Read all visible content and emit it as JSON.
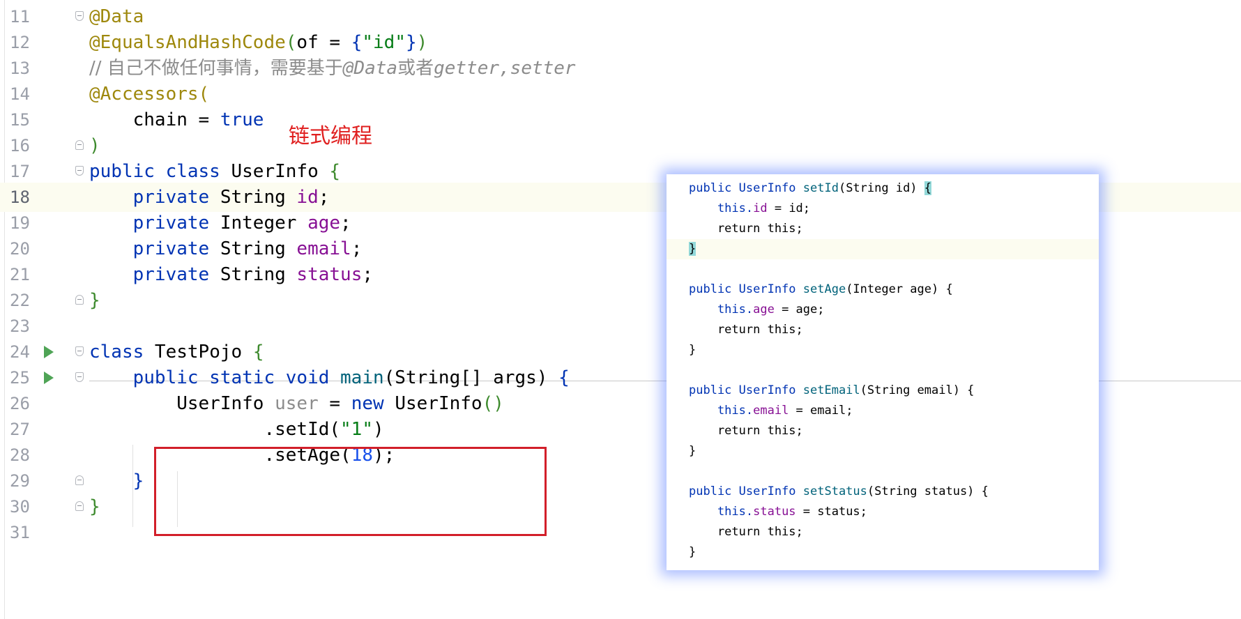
{
  "editor": {
    "lines": [
      {
        "num": "11",
        "tokens": [
          "@Data"
        ]
      },
      {
        "num": "12",
        "tokens": [
          "@EqualsAndHashCode",
          "(",
          "of = ",
          "{",
          "\"id\"",
          "}",
          ")"
        ]
      },
      {
        "num": "13",
        "tokens": [
          "// 自己不做任何事情，需要基于",
          "@Data",
          "或者",
          "getter,setter"
        ]
      },
      {
        "num": "14",
        "tokens": [
          "@Accessors("
        ]
      },
      {
        "num": "15",
        "tokens": [
          "    chain = ",
          "true"
        ]
      },
      {
        "num": "16",
        "tokens": [
          ")"
        ]
      },
      {
        "num": "17",
        "tokens": [
          "public class ",
          "UserInfo ",
          "{"
        ]
      },
      {
        "num": "18",
        "tokens": [
          "    private ",
          "String ",
          "id",
          ";"
        ]
      },
      {
        "num": "19",
        "tokens": [
          "    private ",
          "Integer ",
          "age",
          ";"
        ]
      },
      {
        "num": "20",
        "tokens": [
          "    private ",
          "String ",
          "email",
          ";"
        ]
      },
      {
        "num": "21",
        "tokens": [
          "    private ",
          "String ",
          "status",
          ";"
        ]
      },
      {
        "num": "22",
        "tokens": [
          "}"
        ]
      },
      {
        "num": "23",
        "tokens": []
      },
      {
        "num": "24",
        "tokens": [
          "class ",
          "TestPojo ",
          "{"
        ]
      },
      {
        "num": "25",
        "tokens": [
          "    public static void ",
          "main",
          "(String[] args) ",
          "{"
        ]
      },
      {
        "num": "26",
        "tokens": [
          "        UserInfo ",
          "user",
          " = ",
          "new ",
          "UserInfo",
          "()"
        ]
      },
      {
        "num": "27",
        "tokens": [
          "                .setId(",
          "\"1\"",
          ")"
        ]
      },
      {
        "num": "28",
        "tokens": [
          "                .setAge(",
          "18",
          ");"
        ]
      },
      {
        "num": "29",
        "tokens": [
          "    }"
        ]
      },
      {
        "num": "30",
        "tokens": [
          "}"
        ]
      },
      {
        "num": "31",
        "tokens": []
      }
    ],
    "annotation_note": "链式编程"
  },
  "popup": {
    "lines": [
      [
        "public UserInfo ",
        "setId",
        "(String id) ",
        "{"
      ],
      [
        "    this.",
        "id",
        " = id;"
      ],
      [
        "    return this;"
      ],
      [
        "}"
      ],
      [
        ""
      ],
      [
        "public UserInfo ",
        "setAge",
        "(Integer age) {"
      ],
      [
        "    this.",
        "age",
        " = age;"
      ],
      [
        "    return this;"
      ],
      [
        "}"
      ],
      [
        ""
      ],
      [
        "public UserInfo ",
        "setEmail",
        "(String email) {"
      ],
      [
        "    this.",
        "email",
        " = email;"
      ],
      [
        "    return this;"
      ],
      [
        "}"
      ],
      [
        ""
      ],
      [
        "public UserInfo ",
        "setStatus",
        "(String status) {"
      ],
      [
        "    this.",
        "status",
        " = status;"
      ],
      [
        "    return this;"
      ],
      [
        "}"
      ]
    ]
  },
  "colors": {
    "annotation": "#9e880d",
    "keyword": "#0033b3",
    "string": "#067d17",
    "comment": "#8c8c8c",
    "field": "#871094",
    "method": "#00627a",
    "number": "#1750eb",
    "highlight_box": "#d21f2a",
    "popup_glow": "#466eff"
  },
  "icons": {
    "run": "run-triangle-icon",
    "fold": "fold-marker-icon"
  }
}
